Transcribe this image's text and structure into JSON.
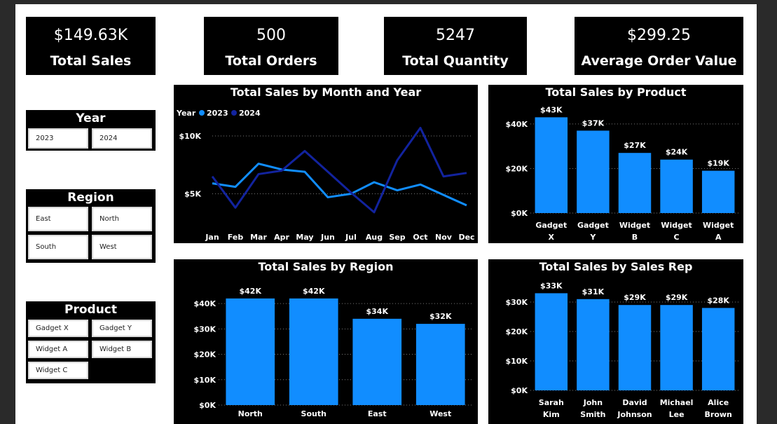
{
  "kpis": [
    {
      "value": "$149.63K",
      "label": "Total Sales"
    },
    {
      "value": "500",
      "label": "Total Orders"
    },
    {
      "value": "5247",
      "label": "Total Quantity"
    },
    {
      "value": "$299.25",
      "label": "Average Order Value"
    }
  ],
  "slicers": {
    "year": {
      "title": "Year",
      "options": [
        "2023",
        "2024"
      ]
    },
    "region": {
      "title": "Region",
      "options": [
        "East",
        "North",
        "South",
        "West"
      ]
    },
    "product": {
      "title": "Product",
      "options": [
        "Gadget X",
        "Gadget Y",
        "Widget A",
        "Widget B",
        "Widget C"
      ]
    }
  },
  "colors": {
    "series_2023": "#118dff",
    "series_2024": "#12239e",
    "bar": "#118dff",
    "panel_bg": "#000000"
  },
  "chart_data": [
    {
      "id": "sales_by_month",
      "type": "line",
      "title": "Total Sales by Month and Year",
      "legend_title": "Year",
      "legend_position": "top-left",
      "x": [
        "Jan",
        "Feb",
        "Mar",
        "Apr",
        "May",
        "Jun",
        "Jul",
        "Aug",
        "Sep",
        "Oct",
        "Nov",
        "Dec"
      ],
      "series": [
        {
          "name": "2023",
          "values": [
            5900,
            5600,
            7600,
            7100,
            6900,
            4700,
            5000,
            6000,
            5300,
            5800,
            4900,
            4000
          ]
        },
        {
          "name": "2024",
          "values": [
            6500,
            3800,
            6700,
            7000,
            8700,
            6900,
            5100,
            3400,
            7900,
            10700,
            6500,
            6800
          ]
        }
      ],
      "ylim": [
        2000,
        12000
      ],
      "yticks": [
        {
          "v": 5000,
          "label": "$5K"
        },
        {
          "v": 10000,
          "label": "$10K"
        }
      ],
      "grid": true
    },
    {
      "id": "sales_by_product",
      "type": "bar",
      "title": "Total Sales by Product",
      "categories": [
        "Gadget X",
        "Gadget Y",
        "Widget B",
        "Widget C",
        "Widget A"
      ],
      "values": [
        43000,
        37000,
        27000,
        24000,
        19000
      ],
      "data_labels": [
        "$43K",
        "$37K",
        "$27K",
        "$24K",
        "$19K"
      ],
      "ylim": [
        0,
        45000
      ],
      "yticks": [
        {
          "v": 0,
          "label": "$0K"
        },
        {
          "v": 20000,
          "label": "$20K"
        },
        {
          "v": 40000,
          "label": "$40K"
        }
      ],
      "grid": true
    },
    {
      "id": "sales_by_region",
      "type": "bar",
      "title": "Total Sales by Region",
      "categories": [
        "North",
        "South",
        "East",
        "West"
      ],
      "values": [
        42000,
        42000,
        34000,
        32000
      ],
      "data_labels": [
        "$42K",
        "$42K",
        "$34K",
        "$32K"
      ],
      "ylim": [
        0,
        45000
      ],
      "yticks": [
        {
          "v": 0,
          "label": "$0K"
        },
        {
          "v": 10000,
          "label": "$10K"
        },
        {
          "v": 20000,
          "label": "$20K"
        },
        {
          "v": 30000,
          "label": "$30K"
        },
        {
          "v": 40000,
          "label": "$40K"
        }
      ],
      "grid": true
    },
    {
      "id": "sales_by_rep",
      "type": "bar",
      "title": "Total Sales by Sales Rep",
      "categories": [
        "Sarah Kim",
        "John Smith",
        "David Johnson",
        "Michael Lee",
        "Alice Brown"
      ],
      "values": [
        33000,
        31000,
        29000,
        29000,
        28000
      ],
      "data_labels": [
        "$33K",
        "$31K",
        "$29K",
        "$29K",
        "$28K"
      ],
      "ylim": [
        0,
        35000
      ],
      "yticks": [
        {
          "v": 0,
          "label": "$0K"
        },
        {
          "v": 10000,
          "label": "$10K"
        },
        {
          "v": 20000,
          "label": "$20K"
        },
        {
          "v": 30000,
          "label": "$30K"
        }
      ],
      "grid": true
    }
  ]
}
